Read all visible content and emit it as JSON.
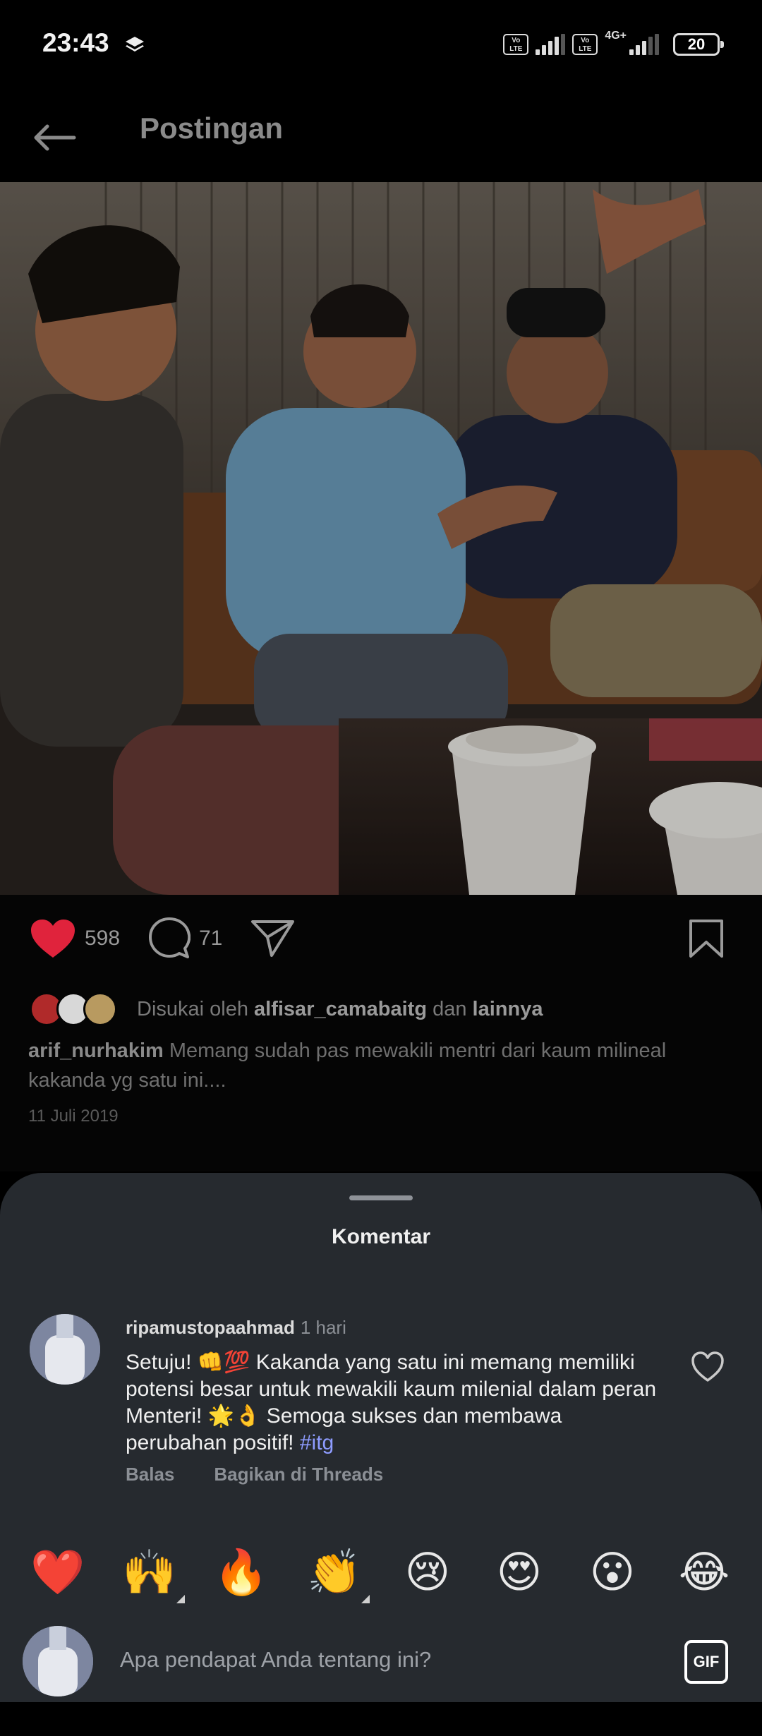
{
  "status_bar": {
    "time": "23:43",
    "network_label": "4G+",
    "volte_label": "Vo\nLTE",
    "battery": "20"
  },
  "header": {
    "title": "Postingan"
  },
  "post": {
    "likes": "598",
    "comments": "71",
    "liked_by_prefix": "Disukai oleh ",
    "liked_by_user": "alfisar_camabaitg",
    "liked_by_mid": " dan ",
    "liked_by_suffix": "lainnya",
    "caption_user": "arif_nurhakim",
    "caption_text": " Memang sudah pas mewakili mentri dari kaum milineal kakanda yg satu ini....",
    "date": "11 Juli 2019"
  },
  "sheet": {
    "title": "Komentar"
  },
  "comment": {
    "username": "ripamustopaahmad",
    "time": "1 hari",
    "text": "Setuju! 👊💯 Kakanda yang satu ini memang memiliki potensi besar untuk mewakili kaum milenial dalam peran Menteri! 🌟👌 Semoga sukses dan membawa perubahan positif! ",
    "hashtag": "#itg",
    "reply_label": "Balas",
    "share_label": "Bagikan di Threads"
  },
  "emoji_reactions": [
    "❤️",
    "🙌",
    "🔥",
    "👏",
    "😢",
    "😍",
    "😮",
    "😂"
  ],
  "input": {
    "placeholder": "Apa pendapat Anda tentang ini?",
    "gif_label": "GIF"
  },
  "colors": {
    "background": "#000000",
    "sheet": "#262a2f",
    "like_red": "#e0233c",
    "hashtag": "#8e9cff"
  }
}
